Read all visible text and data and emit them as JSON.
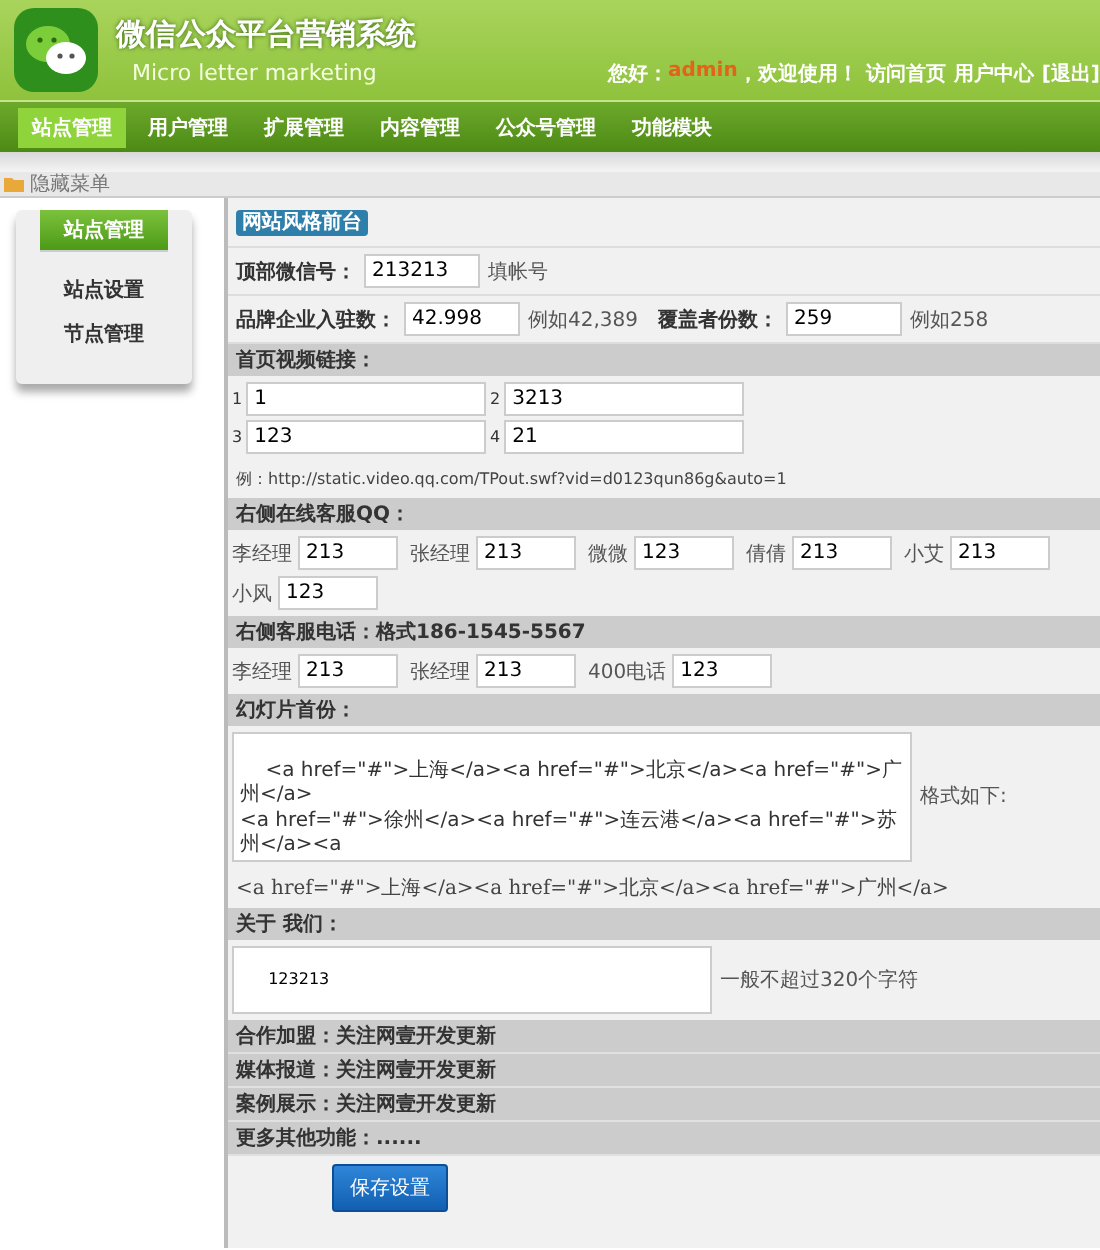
{
  "header": {
    "title": "微信公众平台营销系统",
    "subtitle": "Micro letter marketing",
    "greeting": "您好：",
    "username": "admin",
    "welcome": "，欢迎使用！",
    "links": [
      "访问首页",
      "用户中心",
      "[退出]"
    ]
  },
  "nav": [
    {
      "label": "站点管理",
      "selected": true
    },
    {
      "label": "用户管理",
      "selected": false
    },
    {
      "label": "扩展管理",
      "selected": false
    },
    {
      "label": "内容管理",
      "selected": false
    },
    {
      "label": "公众号管理",
      "selected": false
    },
    {
      "label": "功能模块",
      "selected": false
    }
  ],
  "breadcrumb": "隐藏菜单",
  "sidebar": {
    "heading": "站点管理",
    "items": [
      "站点设置",
      "节点管理"
    ]
  },
  "panel_title": "网站风格前台",
  "field_rows": [
    [
      {
        "label": "顶部微信号：",
        "value": "213213",
        "hint": "填帐号"
      }
    ],
    [
      {
        "label": "品牌企业入驻数：",
        "value": "42.998",
        "hint": "例如42,389"
      },
      {
        "label": "覆盖者份数：",
        "value": "259",
        "hint": "例如258"
      }
    ]
  ],
  "video": {
    "heading": "首页视频链接：",
    "links": [
      {
        "index": "1",
        "value": "1"
      },
      {
        "index": "2",
        "value": "3213"
      },
      {
        "index": "3",
        "value": "123"
      },
      {
        "index": "4",
        "value": "21"
      }
    ],
    "example": "例：http://static.video.qq.com/TPout.swf?vid=d0123qun86g&auto=1"
  },
  "qq": {
    "heading": "右侧在线客服QQ：",
    "fields": [
      {
        "label": "李经理",
        "value": "213"
      },
      {
        "label": "张经理",
        "value": "213"
      },
      {
        "label": "微微",
        "value": "123"
      },
      {
        "label": "倩倩",
        "value": "213"
      },
      {
        "label": "小艾",
        "value": "213"
      },
      {
        "label": "小风",
        "value": "123"
      }
    ]
  },
  "phone": {
    "heading": "右侧客服电话：格式186-1545-5567",
    "fields": [
      {
        "label": "李经理",
        "value": "213"
      },
      {
        "label": "张经理",
        "value": "213"
      },
      {
        "label": "400电话",
        "value": "123"
      }
    ]
  },
  "slides": {
    "heading": "幻灯片首份：",
    "value": "\n    <a href=\"#\">上海</a><a href=\"#\">北京</a><a href=\"#\">广州</a>\n<a href=\"#\">徐州</a><a href=\"#\">连云港</a><a href=\"#\">苏州</a><a",
    "note": "格式如下:",
    "example": "<a href=\"#\">上海</a><a href=\"#\">北京</a><a href=\"#\">广州</a>"
  },
  "about": {
    "heading": "关于 我们：",
    "value": "\n  123213",
    "note": "一般不超过320个字符"
  },
  "info_rows": [
    "合作加盟：关注网壹开发更新",
    "媒体报道：关注网壹开发更新",
    "案例展示：关注网壹开发更新",
    "更多其他功能：......"
  ],
  "save_button": "保存设置"
}
